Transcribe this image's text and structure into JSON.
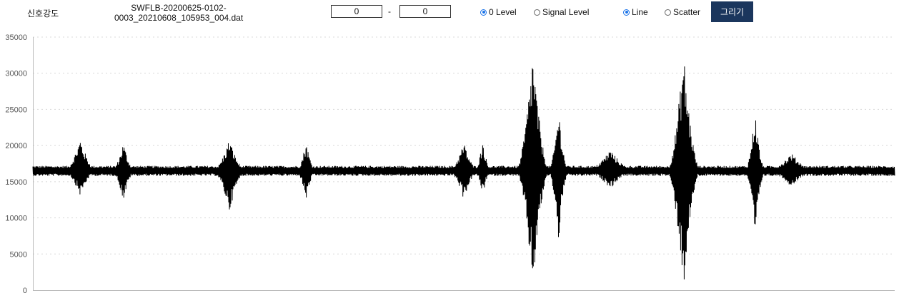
{
  "controls": {
    "signal_label": "신호강도",
    "file_name_line1": "SWFLB-20200625-0102-",
    "file_name_line2": "0003_20210608_105953_004.dat",
    "range_start": "0",
    "range_separator": "-",
    "range_end": "0",
    "level_options": [
      {
        "label": "0 Level",
        "selected": true
      },
      {
        "label": "Signal Level",
        "selected": false
      }
    ],
    "style_options": [
      {
        "label": "Line",
        "selected": true
      },
      {
        "label": "Scatter",
        "selected": false
      }
    ],
    "draw_button": "그리기",
    "accent_color": "#1b365d",
    "radio_color": "#1a73e8"
  },
  "chart_data": {
    "type": "line",
    "title": "",
    "xlabel": "",
    "ylabel": "",
    "ylim": [
      0,
      35000
    ],
    "yticks": [
      0,
      5000,
      10000,
      15000,
      20000,
      25000,
      30000,
      35000
    ],
    "grid": "horizontal dotted",
    "baseline": 16500,
    "line_color": "#000000",
    "series": [
      {
        "name": "",
        "bursts": [
          {
            "x": 0.055,
            "max": 21000,
            "min": 13000,
            "width": 0.02
          },
          {
            "x": 0.105,
            "max": 20500,
            "min": 12300,
            "width": 0.014
          },
          {
            "x": 0.228,
            "max": 21000,
            "min": 10800,
            "width": 0.02
          },
          {
            "x": 0.317,
            "max": 20600,
            "min": 12400,
            "width": 0.012
          },
          {
            "x": 0.5,
            "max": 20500,
            "min": 12500,
            "width": 0.018
          },
          {
            "x": 0.522,
            "max": 20800,
            "min": 13000,
            "width": 0.01
          },
          {
            "x": 0.58,
            "max": 33300,
            "min": 0,
            "width": 0.02
          },
          {
            "x": 0.61,
            "max": 25300,
            "min": 6500,
            "width": 0.012
          },
          {
            "x": 0.67,
            "max": 19500,
            "min": 14000,
            "width": 0.03
          },
          {
            "x": 0.755,
            "max": 33200,
            "min": 0,
            "width": 0.02
          },
          {
            "x": 0.838,
            "max": 24900,
            "min": 6800,
            "width": 0.012
          },
          {
            "x": 0.88,
            "max": 19000,
            "min": 14300,
            "width": 0.03
          }
        ]
      }
    ]
  }
}
